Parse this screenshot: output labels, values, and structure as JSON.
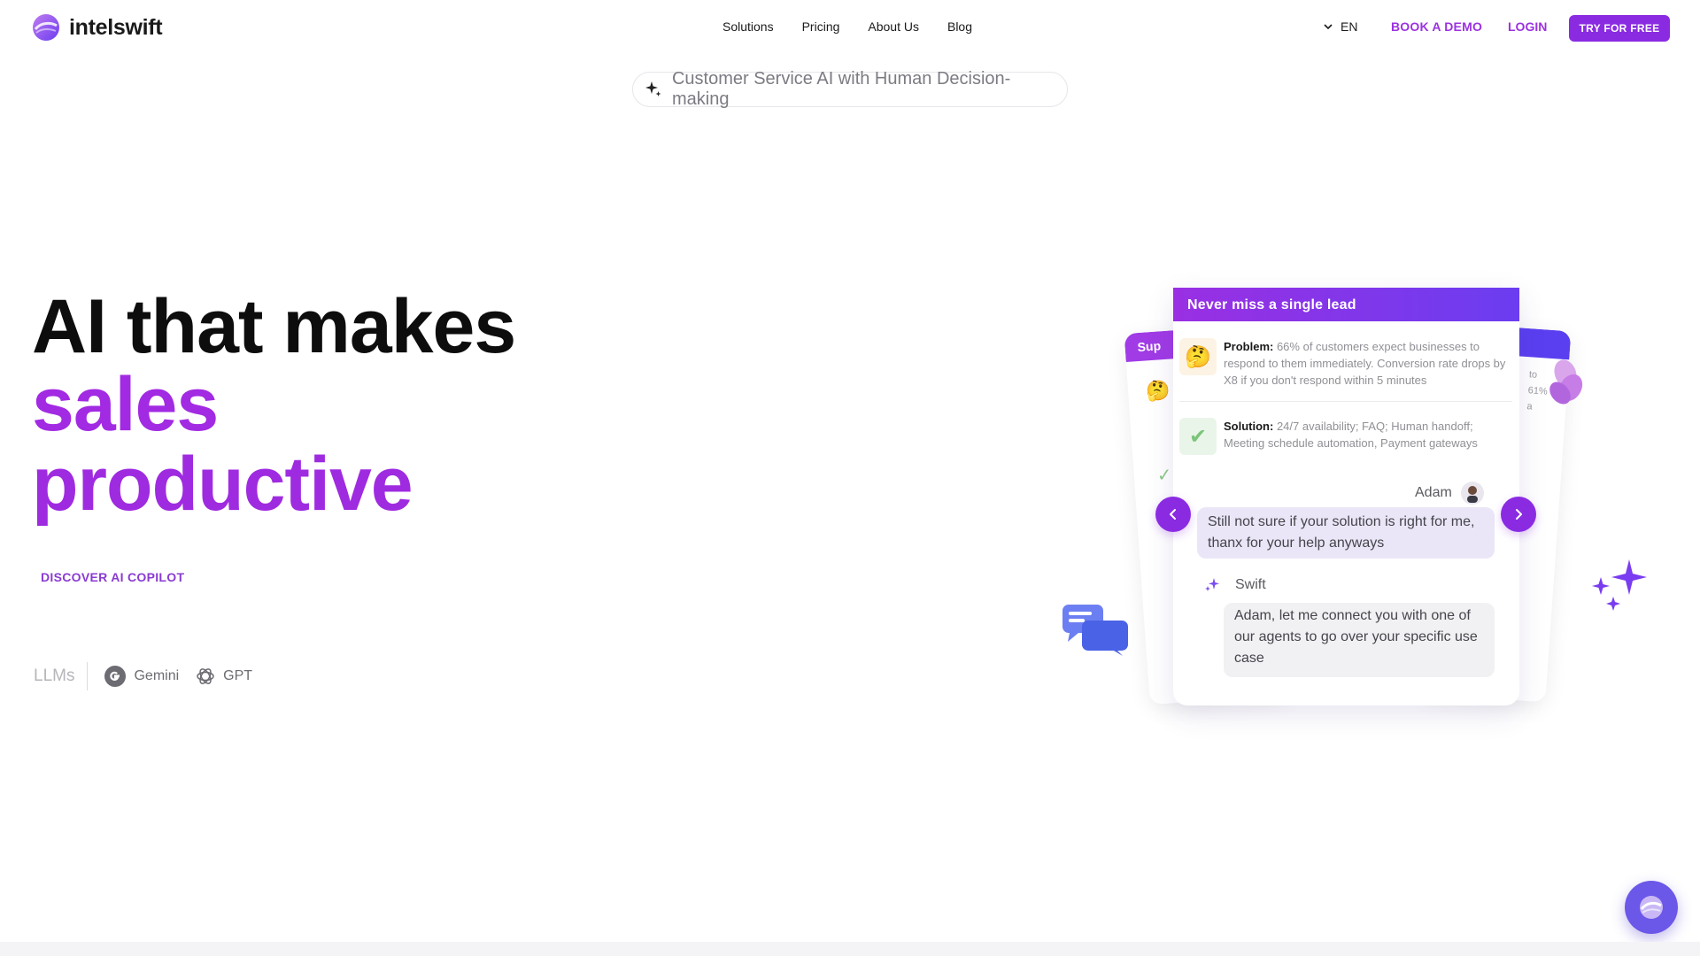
{
  "header": {
    "brand": "intelswift",
    "nav": [
      "Solutions",
      "Pricing",
      "About Us",
      "Blog"
    ],
    "language": "EN",
    "book_demo": "BOOK A DEMO",
    "login": "LOGIN",
    "try_free": "TRY FOR FREE"
  },
  "tagline": "Customer Service AI with Human Decision-making",
  "hero": {
    "line1": "AI that makes",
    "line2": "sales",
    "line3": "productive",
    "cta": "DISCOVER AI COPILOT"
  },
  "llms": {
    "label": "LLMs",
    "items": [
      "Gemini",
      "GPT"
    ]
  },
  "card": {
    "title": "Never miss a single lead",
    "problem_label": "Problem:",
    "problem_text": " 66% of customers expect businesses to respond to them immediately. Conversion rate drops by X8 if you don't respond within 5 minutes",
    "solution_label": "Solution:",
    "solution_text": " 24/7 availability; FAQ; Human handoff; Meeting schedule automation, Payment gateways",
    "user_name": "Adam",
    "user_message": "Still not sure if your solution is right for me, thanx for your help anyways",
    "bot_name": "Swift",
    "bot_message": "Adam, let me connect you with one of our agents to go over your specific use case"
  },
  "back_cards": {
    "left_header": "Sup",
    "right_fragments": [
      "to",
      "61%",
      "a"
    ]
  },
  "colors": {
    "brand_purple": "#8a2be2",
    "hero_purple": "#a22ae3",
    "card_gradient_start": "#9a2fe3",
    "card_gradient_end": "#6b3df0"
  }
}
